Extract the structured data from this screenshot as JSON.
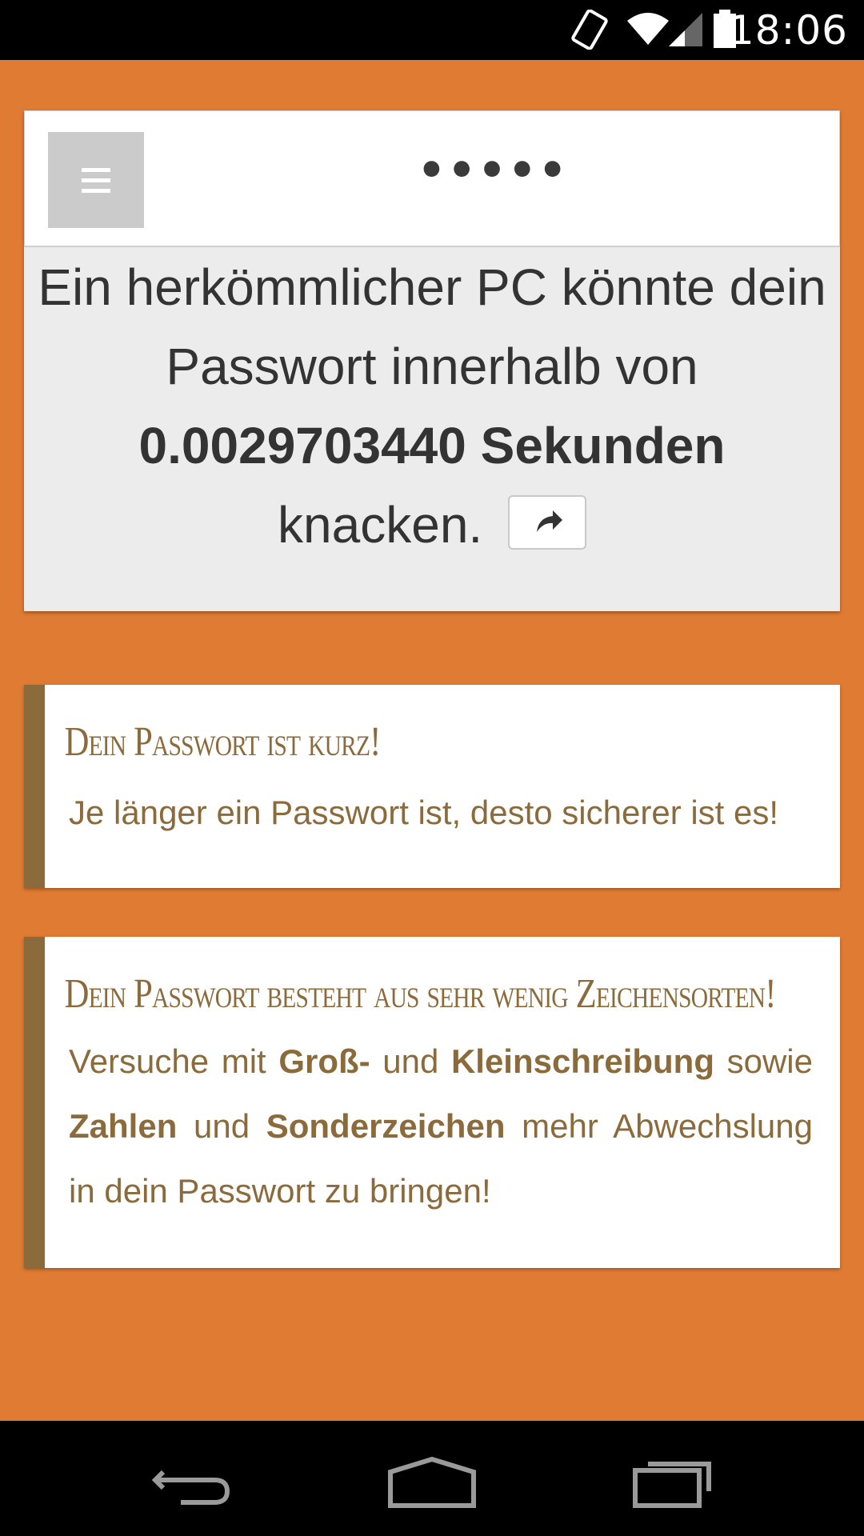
{
  "status_bar": {
    "time": "18:06",
    "icons": [
      "vibrate-icon",
      "wifi-icon",
      "cell-signal-icon",
      "battery-icon"
    ]
  },
  "password_field": {
    "value": "•••••",
    "menu_icon": "hamburger-menu-icon"
  },
  "result": {
    "prefix": "Ein herkömmlicher PC könnte dein Passwort innerhalb von",
    "time": "0.0029703440 Sekunden",
    "suffix": "knacken.",
    "share_icon": "share-icon"
  },
  "tips": [
    {
      "title": "Dein Passwort ist kurz!",
      "body": "Je länger ein Passwort ist, desto sicherer ist es!"
    },
    {
      "title": "Dein Passwort besteht aus sehr wenig Zeichensorten!",
      "body_parts": {
        "p1": "Versuche mit ",
        "b1": "Groß-",
        "p2": " und ",
        "b2": "Kleinschreibung",
        "p3": " sowie ",
        "b3": "Zahlen",
        "p4": " und ",
        "b4": "Sonderzeichen",
        "p5": " mehr Abwechslung in dein Passwort zu bringen!"
      }
    }
  ],
  "colors": {
    "background": "#e07b33",
    "accent": "#8b6b3c"
  },
  "nav_bar": {
    "icons": [
      "back-icon",
      "home-icon",
      "recents-icon"
    ]
  }
}
